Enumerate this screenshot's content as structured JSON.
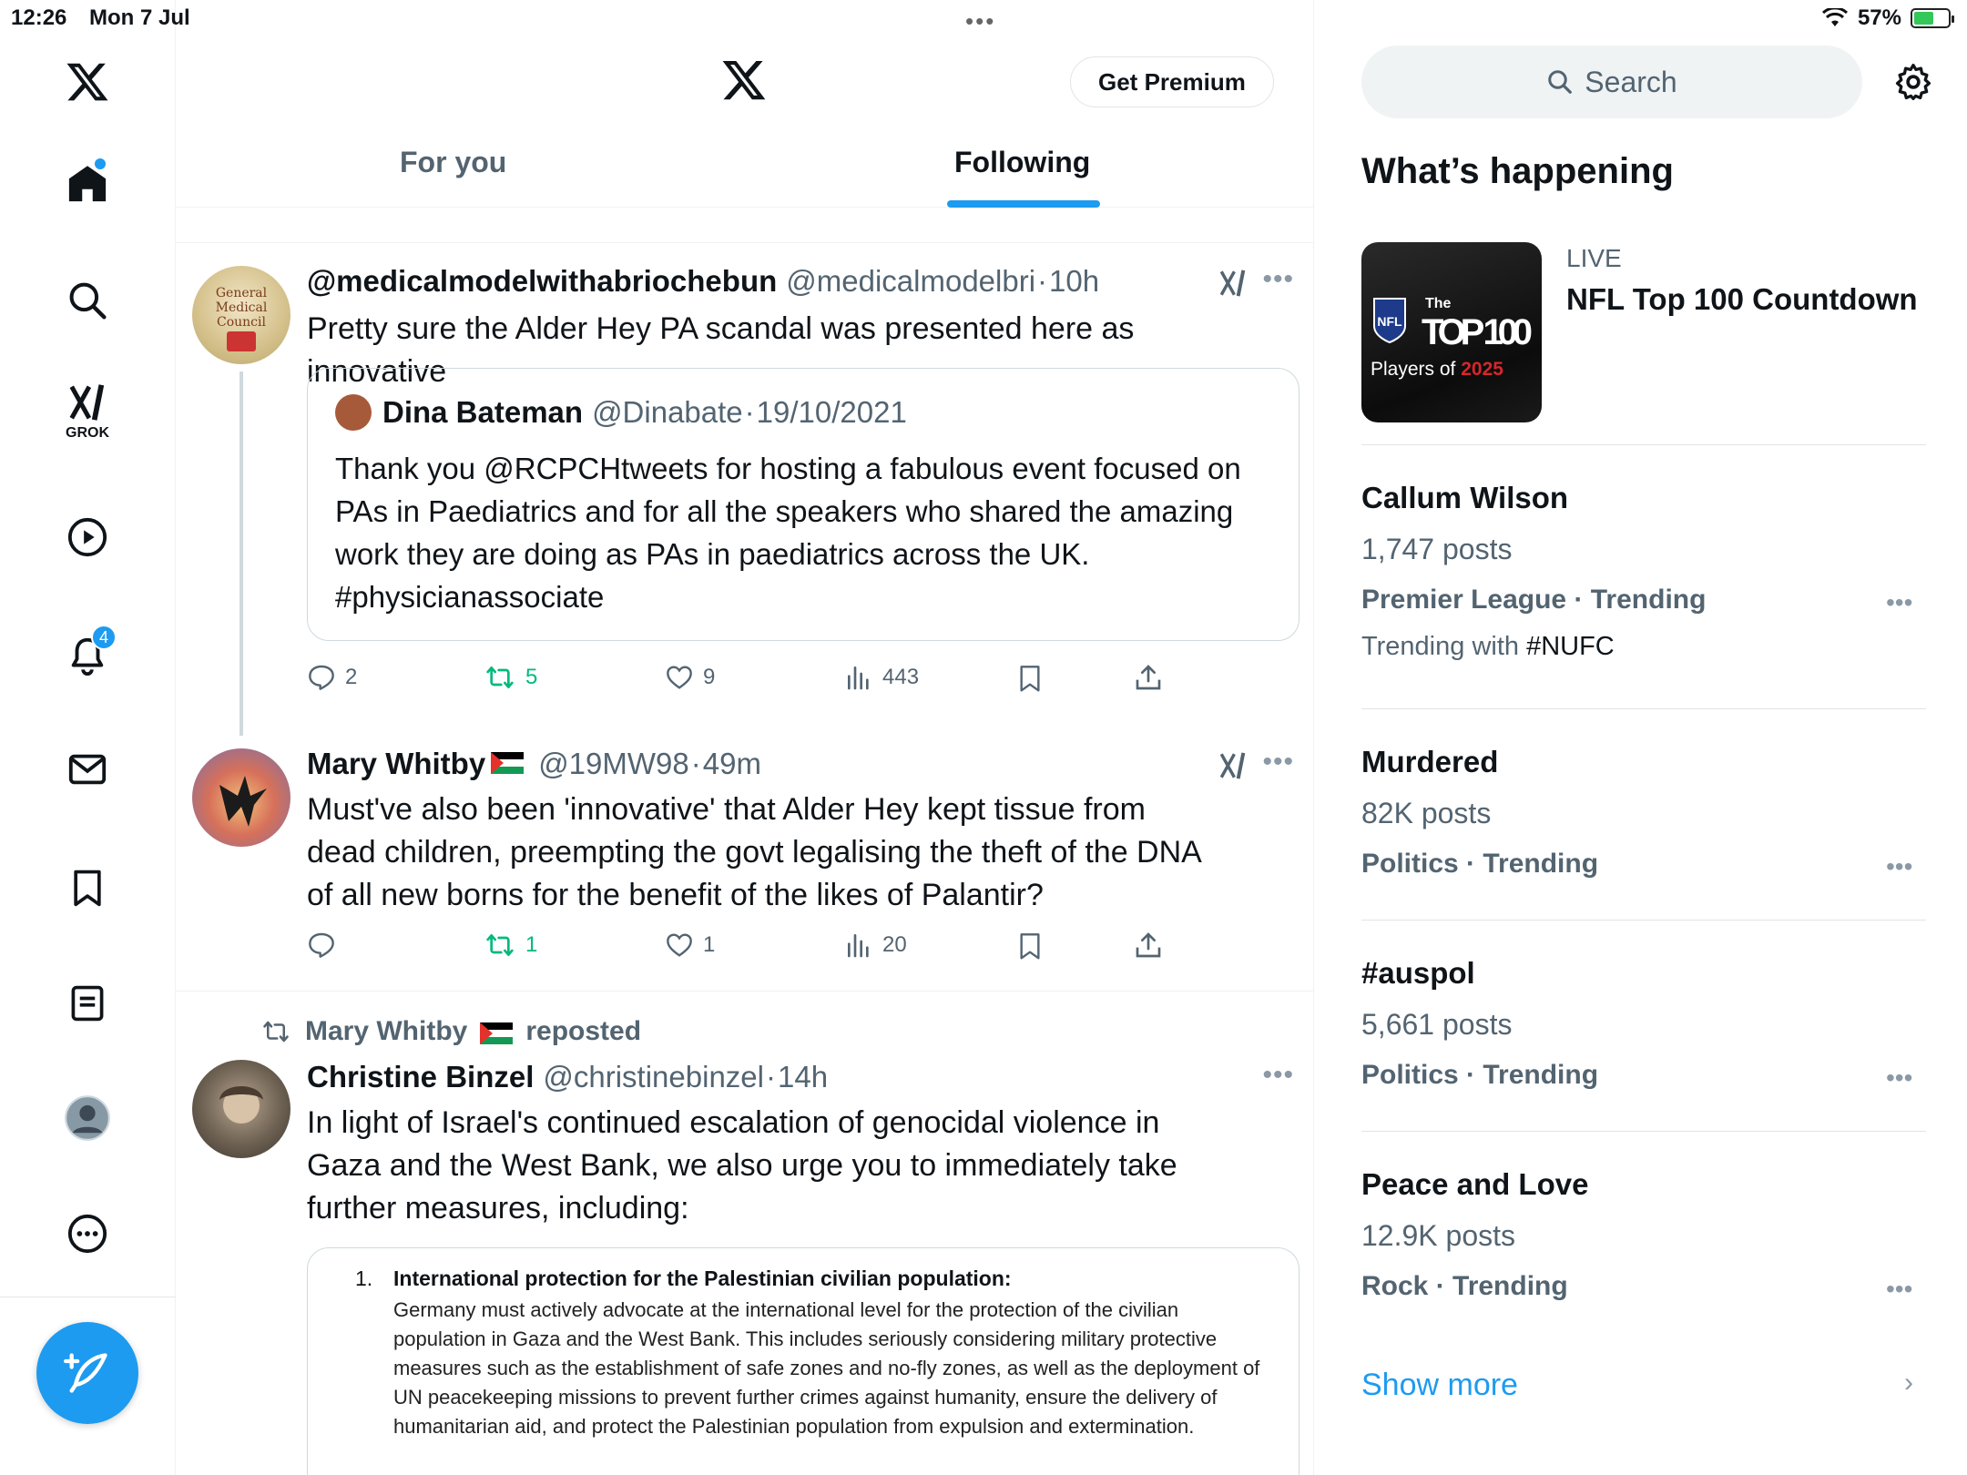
{
  "status": {
    "time": "12:26",
    "date": "Mon 7 Jul",
    "battery": "57%",
    "battery_level": 0.57
  },
  "nav": {
    "items": [
      {
        "icon": "x-logo-icon"
      },
      {
        "icon": "home-icon"
      },
      {
        "icon": "search-icon"
      },
      {
        "icon": "grok-icon",
        "label": "GROK"
      },
      {
        "icon": "video-play-icon"
      },
      {
        "icon": "notifications-icon",
        "badge": "4"
      },
      {
        "icon": "messages-icon"
      },
      {
        "icon": "bookmarks-icon"
      },
      {
        "icon": "lists-icon"
      },
      {
        "icon": "profile-icon"
      },
      {
        "icon": "more-icon"
      }
    ],
    "compose_icon": "compose-icon"
  },
  "header": {
    "premium_label": "Get Premium",
    "tabs": [
      {
        "label": "For you"
      },
      {
        "label": "Following",
        "active": true
      }
    ]
  },
  "tweets": [
    {
      "name": "@medicalmodelwithabriochebun",
      "handle": "@medicalmodelbri",
      "time": "10h",
      "text": "Pretty sure the Alder Hey PA scandal was presented here as innovative",
      "quote": {
        "name": "Dina Bateman",
        "handle": "@Dinabate",
        "date": "19/10/2021",
        "text": "Thank you @RCPCHtweets for hosting a fabulous event focused on PAs in Paediatrics and for all the speakers who shared the amazing work they are doing as PAs in paediatrics across the UK. #physicianassociate"
      },
      "stats": {
        "replies": "2",
        "reposts": "5",
        "likes": "9",
        "views": "443"
      }
    },
    {
      "name": "Mary Whitby",
      "handle": "@19MW98",
      "time": "49m",
      "text": "Must've also been 'innovative' that Alder Hey kept tissue from dead children, preempting the govt legalising the theft of the DNA of all new borns for the benefit of the likes of Palantir?",
      "stats": {
        "replies": "",
        "reposts": "1",
        "likes": "1",
        "views": "20"
      }
    },
    {
      "reposted_by": "Mary Whitby",
      "reposted_label": "reposted",
      "name": "Christine Binzel",
      "handle": "@christinebinzel",
      "time": "14h",
      "text": "In light of Israel's continued escalation of genocidal violence in Gaza and the West Bank, we also urge you to immediately take further measures, including:",
      "doc": {
        "num": "1.",
        "title": "International protection for the Palestinian civilian population:",
        "text": "Germany must actively advocate at the international level for the protection of the civilian population in Gaza and the West Bank. This includes seriously considering military protective measures such as the establishment of safe zones and no-fly zones, as well as the deployment of UN peacekeeping missions to prevent further crimes against humanity, ensure the delivery of humanitarian aid, and protect the Palestinian population from expulsion and extermination."
      }
    }
  ],
  "sidebar": {
    "search_placeholder": "Search",
    "title": "What’s happening",
    "live": {
      "label": "LIVE",
      "title": "NFL Top 100 Countdown",
      "img_the": "The",
      "img_top": "TOP 100",
      "img_players": "Players of ",
      "img_year": "2025",
      "img_nfl": "NFL"
    },
    "trends": [
      {
        "name": "Callum Wilson",
        "posts": "1,747 posts",
        "context": "Premier League · Trending",
        "with_label": "Trending with ",
        "with_tag": "#NUFC"
      },
      {
        "name": "Murdered",
        "posts": "82K posts",
        "context": "Politics · Trending"
      },
      {
        "name": "#auspol",
        "posts": "5,661 posts",
        "context": "Politics · Trending"
      },
      {
        "name": "Peace and Love",
        "posts": "12.9K posts",
        "context": "Rock · Trending"
      }
    ],
    "show_more": "Show more"
  },
  "colors": {
    "accent": "#1d9bf0",
    "repost_green": "#00ba7c",
    "muted": "#536471"
  }
}
